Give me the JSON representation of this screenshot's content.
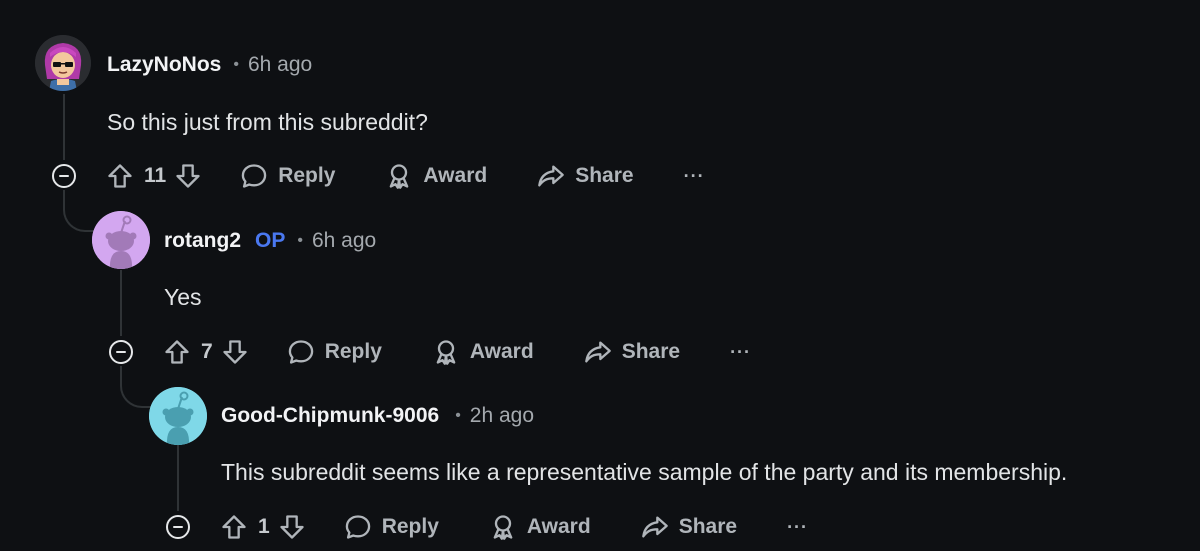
{
  "comments": [
    {
      "username": "LazyNoNos",
      "op_badge": "",
      "separator": "•",
      "time": "6h ago",
      "body": "So this just from this subreddit?",
      "votes": "11",
      "reply_label": "Reply",
      "award_label": "Award",
      "share_label": "Share",
      "more_label": "···",
      "avatar": "custom-character-avatar"
    },
    {
      "username": "rotang2",
      "op_badge": "OP",
      "separator": "•",
      "time": "6h ago",
      "body": "Yes",
      "votes": "7",
      "reply_label": "Reply",
      "award_label": "Award",
      "share_label": "Share",
      "more_label": "···",
      "avatar": "snoo-avatar",
      "avatar_color": "#d3a7f0"
    },
    {
      "username": "Good-Chipmunk-9006",
      "op_badge": "",
      "separator": "•",
      "time": "2h ago",
      "body": "This subreddit seems like a representative sample of the party and its membership.",
      "votes": "1",
      "reply_label": "Reply",
      "award_label": "Award",
      "share_label": "Share",
      "more_label": "···",
      "avatar": "snoo-avatar",
      "avatar_color": "#7fd8e8"
    }
  ],
  "colors": {
    "background": "#0e1013",
    "thread_line": "#2f3336",
    "op_badge": "#4a78f0",
    "text": "#e2e4e6",
    "muted": "#a4a9ae"
  }
}
